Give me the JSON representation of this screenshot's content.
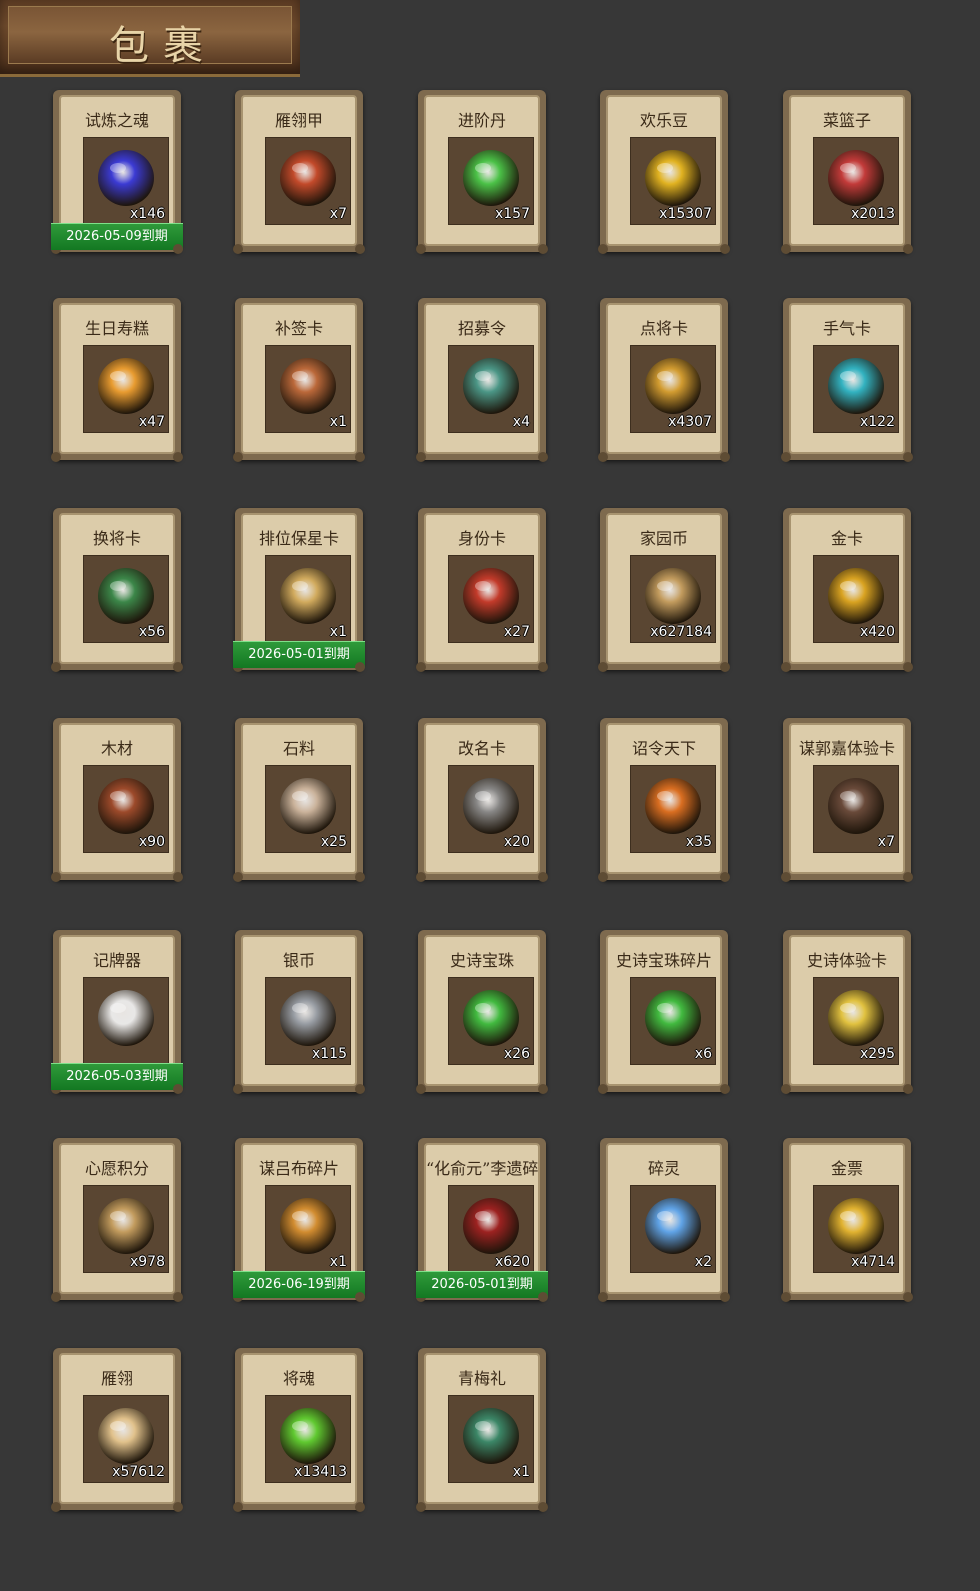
{
  "header": {
    "title": "包裹"
  },
  "items": [
    {
      "name": "试炼之魂",
      "qty": "x146",
      "expiry": "2026-05-09到期",
      "icon": "blue-dragon-orb-icon",
      "color": "#3a3adc"
    },
    {
      "name": "雁翎甲",
      "qty": "x7",
      "expiry": "",
      "icon": "armor-icon",
      "color": "#c84a2a"
    },
    {
      "name": "进阶丹",
      "qty": "x157",
      "expiry": "",
      "icon": "green-pill-icon",
      "color": "#4ac848"
    },
    {
      "name": "欢乐豆",
      "qty": "x15307",
      "expiry": "",
      "icon": "golden-beans-icon",
      "color": "#e8b820"
    },
    {
      "name": "菜篮子",
      "qty": "x2013",
      "expiry": "",
      "icon": "flower-basket-icon",
      "color": "#c83a3a"
    },
    {
      "name": "生日寿糕",
      "qty": "x47",
      "expiry": "",
      "icon": "birthday-cake-icon",
      "color": "#f0a030"
    },
    {
      "name": "补签卡",
      "qty": "x1",
      "expiry": "",
      "icon": "sign-card-icon",
      "color": "#c06a3a"
    },
    {
      "name": "招募令",
      "qty": "x4",
      "expiry": "",
      "icon": "recruit-token-icon",
      "color": "#4a9a8a"
    },
    {
      "name": "点将卡",
      "qty": "x4307",
      "expiry": "",
      "icon": "general-card-icon",
      "color": "#d8a030"
    },
    {
      "name": "手气卡",
      "qty": "x122",
      "expiry": "",
      "icon": "luck-card-icon",
      "color": "#30b8c8"
    },
    {
      "name": "换将卡",
      "qty": "x56",
      "expiry": "",
      "icon": "swap-general-card-icon",
      "color": "#3a8a4a"
    },
    {
      "name": "排位保星卡",
      "qty": "x1",
      "expiry": "2026-05-01到期",
      "icon": "rank-star-card-icon",
      "color": "#d8b060"
    },
    {
      "name": "身份卡",
      "qty": "x27",
      "expiry": "",
      "icon": "identity-mask-icon",
      "color": "#c83a2a"
    },
    {
      "name": "家园币",
      "qty": "x627184",
      "expiry": "",
      "icon": "home-coin-icon",
      "color": "#c8a060"
    },
    {
      "name": "金卡",
      "qty": "x420",
      "expiry": "",
      "icon": "gold-card-icon",
      "color": "#e0a820"
    },
    {
      "name": "木材",
      "qty": "x90",
      "expiry": "",
      "icon": "wood-icon",
      "color": "#a04a2a"
    },
    {
      "name": "石料",
      "qty": "x25",
      "expiry": "",
      "icon": "stone-icon",
      "color": "#d0b8a0"
    },
    {
      "name": "改名卡",
      "qty": "x20",
      "expiry": "",
      "icon": "rename-card-icon",
      "color": "#8a8a8a"
    },
    {
      "name": "诏令天下",
      "qty": "x35",
      "expiry": "",
      "icon": "edict-scroll-icon",
      "color": "#e07020"
    },
    {
      "name": "谋郭嘉体验卡",
      "qty": "x7",
      "expiry": "",
      "icon": "hero-portrait-icon",
      "color": "#6a4a3a"
    },
    {
      "name": "记牌器",
      "qty": "",
      "expiry": "2026-05-03到期",
      "icon": "playing-cards-icon",
      "color": "#f0f0f0"
    },
    {
      "name": "银币",
      "qty": "x115",
      "expiry": "",
      "icon": "silver-coins-icon",
      "color": "#9aa0a8"
    },
    {
      "name": "史诗宝珠",
      "qty": "x26",
      "expiry": "",
      "icon": "green-orb-icon",
      "color": "#40c040"
    },
    {
      "name": "史诗宝珠碎片",
      "qty": "x6",
      "expiry": "",
      "icon": "green-shard-icon",
      "color": "#40c040"
    },
    {
      "name": "史诗体验卡",
      "qty": "x295",
      "expiry": "",
      "icon": "gold-ticket-icon",
      "color": "#e8c840"
    },
    {
      "name": "心愿积分",
      "qty": "x978",
      "expiry": "",
      "icon": "heart-coin-icon",
      "color": "#c8a060"
    },
    {
      "name": "谋吕布碎片",
      "qty": "x1",
      "expiry": "2026-06-19到期",
      "icon": "puzzle-piece-icon",
      "color": "#d89030"
    },
    {
      "name": "“化俞元”李遗碎片",
      "qty": "x620",
      "expiry": "2026-05-01到期",
      "icon": "warrior-portrait-icon",
      "color": "#a02020"
    },
    {
      "name": "碎灵",
      "qty": "x2",
      "expiry": "",
      "icon": "blue-crystal-icon",
      "color": "#60a8f0"
    },
    {
      "name": "金票",
      "qty": "x4714",
      "expiry": "",
      "icon": "gold-ticket-scroll-icon",
      "color": "#e8b830"
    },
    {
      "name": "雁翎",
      "qty": "x57612",
      "expiry": "",
      "icon": "feather-icon",
      "color": "#e8c890"
    },
    {
      "name": "将魂",
      "qty": "x13413",
      "expiry": "",
      "icon": "general-soul-icon",
      "color": "#60d030"
    },
    {
      "name": "青梅礼",
      "qty": "x1",
      "expiry": "",
      "icon": "gift-bag-icon",
      "color": "#3a8a6a"
    }
  ]
}
